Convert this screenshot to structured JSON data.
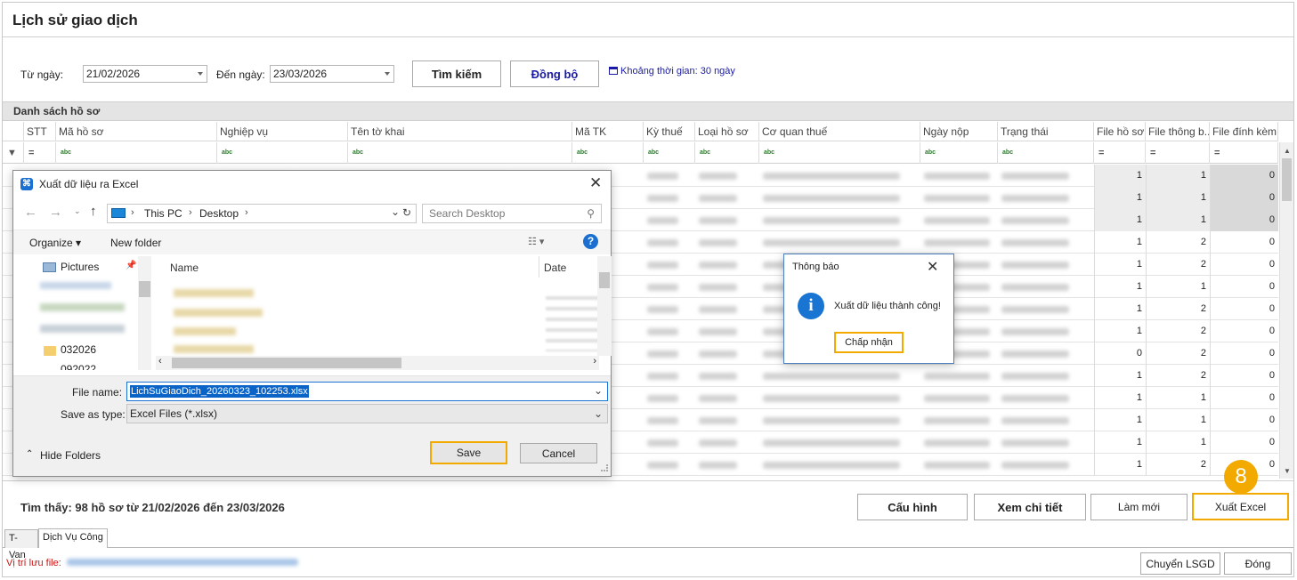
{
  "window": {
    "title": "Lịch sử giao dịch"
  },
  "filter": {
    "from_label": "Từ ngày:",
    "from_value": "21/02/2026",
    "to_label": "Đến ngày:",
    "to_value": "23/03/2026",
    "search_btn": "Tìm kiếm",
    "sync_btn": "Đồng bộ",
    "period_text": "Khoảng thời gian: 30 ngày"
  },
  "section": {
    "title": "Danh sách hồ sơ"
  },
  "table": {
    "columns": [
      "STT",
      "Mã hồ sơ",
      "Nghiệp vụ",
      "Tên tờ khai",
      "Mã TK",
      "Kỳ thuế",
      "Loại hồ sơ",
      "Cơ quan thuế",
      "Ngày nộp",
      "Trạng thái",
      "File hồ sơ",
      "File thông b...",
      "File đính kèm"
    ],
    "filter_icons": [
      "=",
      "abc",
      "abc",
      "abc",
      "abc",
      "abc",
      "abc",
      "abc",
      "abc",
      "abc",
      "=",
      "=",
      "="
    ],
    "rows": [
      [
        1,
        1,
        0
      ],
      [
        1,
        1,
        0
      ],
      [
        1,
        1,
        0
      ],
      [
        1,
        2,
        0
      ],
      [
        1,
        2,
        0
      ],
      [
        1,
        1,
        0
      ],
      [
        1,
        2,
        0
      ],
      [
        1,
        2,
        0
      ],
      [
        0,
        2,
        0
      ],
      [
        1,
        2,
        0
      ],
      [
        1,
        1,
        0
      ],
      [
        1,
        1,
        0
      ],
      [
        1,
        1,
        0
      ],
      [
        1,
        2,
        0
      ]
    ]
  },
  "footer": {
    "summary": "Tìm thấy: 98 hồ sơ từ 21/02/2026 đến 23/03/2026",
    "config_btn": "Cấu hình",
    "detail_btn": "Xem chi tiết",
    "refresh_btn": "Làm mới",
    "export_btn": "Xuất Excel",
    "step_badge": "8"
  },
  "tabs": [
    "T-Van",
    "Dịch Vụ Công"
  ],
  "bottom": {
    "save_location_label": "Vị trí lưu file:",
    "transfer_btn": "Chuyển LSGD",
    "close_btn": "Đóng"
  },
  "save_dialog": {
    "title": "Xuất dữ liệu ra Excel",
    "breadcrumb": [
      "This PC",
      "Desktop"
    ],
    "search_placeholder": "Search Desktop",
    "organize": "Organize",
    "new_folder": "New folder",
    "nav_items": [
      "Pictures",
      "032026",
      "092022"
    ],
    "col_name": "Name",
    "col_date": "Date",
    "file_name_label": "File name:",
    "file_name_value": "LichSuGiaoDich_20260323_102253.xlsx",
    "save_type_label": "Save as type:",
    "save_type_value": "Excel Files (*.xlsx)",
    "hide_folders": "Hide Folders",
    "save_btn": "Save",
    "cancel_btn": "Cancel"
  },
  "msg_dialog": {
    "title": "Thông báo",
    "message": "Xuất dữ liệu thành công!",
    "ok_btn": "Chấp nhận"
  },
  "colors": {
    "accent": "#f2a900",
    "link": "#1a1aa6",
    "info": "#1a74d2",
    "selection": "#0a64c8"
  }
}
